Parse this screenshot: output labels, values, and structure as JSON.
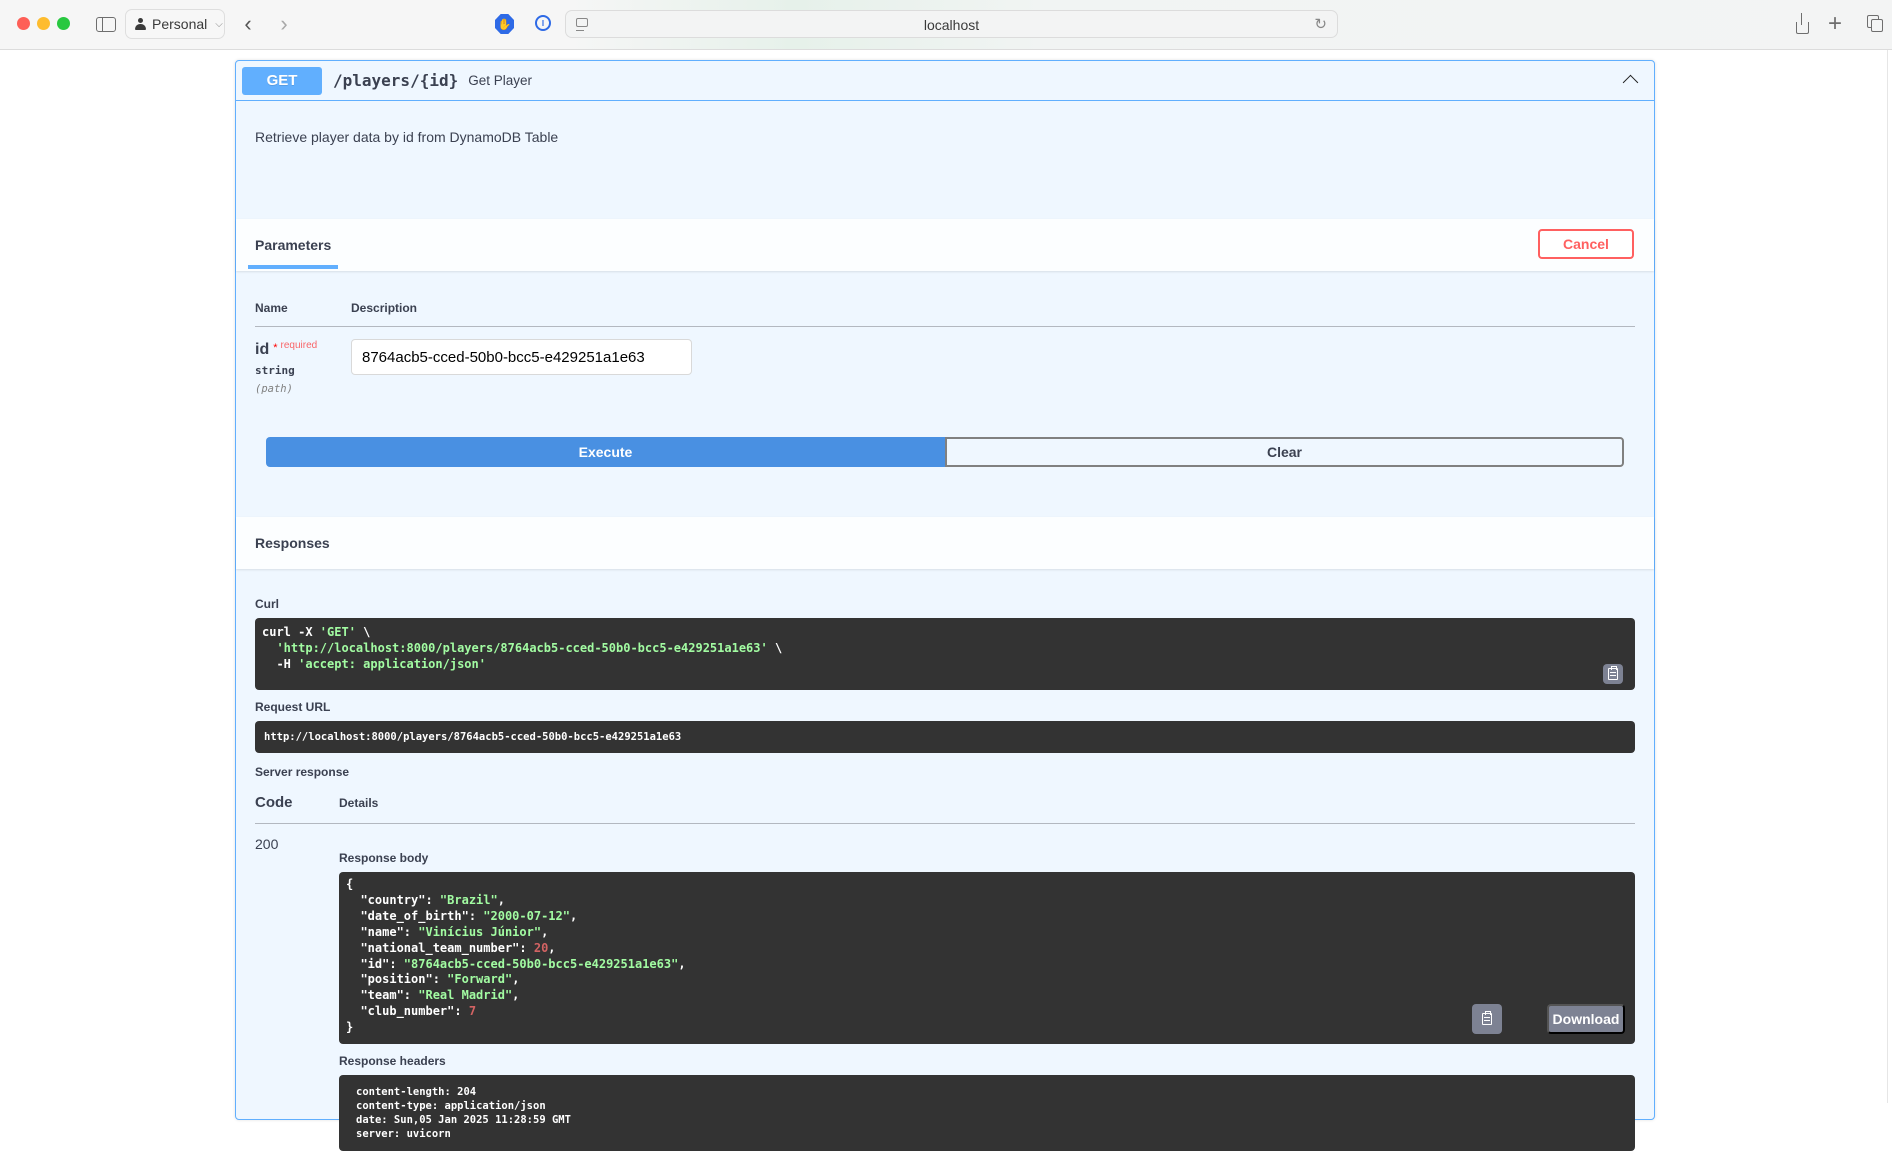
{
  "browser": {
    "profile_label": "Personal",
    "url": "localhost",
    "icons": [
      "sidebar-toggle-icon",
      "person-icon",
      "chevron-left-icon",
      "chevron-right-icon",
      "hand-block-extension-icon",
      "password-extension-icon",
      "page-icon",
      "reload-icon",
      "share-icon",
      "plus-icon",
      "tabs-overview-icon"
    ]
  },
  "operation": {
    "method": "GET",
    "path": "/players/{id}",
    "summary": "Get Player",
    "description": "Retrieve player data by id from DynamoDB Table",
    "method_color": "#61affe"
  },
  "parameters": {
    "tab_label": "Parameters",
    "cancel_label": "Cancel",
    "header_name": "Name",
    "header_description": "Description",
    "items": [
      {
        "name": "id",
        "required_star": "*",
        "required_label": "required",
        "type": "string",
        "in": "(path)",
        "value": "8764acb5-cced-50b0-bcc5-e429251a1e63"
      }
    ]
  },
  "actions": {
    "execute_label": "Execute",
    "clear_label": "Clear",
    "execute_color": "#4990e2"
  },
  "responses": {
    "title": "Responses",
    "curl_label": "Curl",
    "curl_lines": [
      {
        "plain": "curl -X ",
        "str": "'GET'",
        "tail": " \\"
      },
      {
        "plain": "  ",
        "str": "'http://localhost:8000/players/8764acb5-cced-50b0-bcc5-e429251a1e63'",
        "tail": " \\"
      },
      {
        "plain": "  -H ",
        "str": "'accept: application/json'",
        "tail": ""
      }
    ],
    "request_url_label": "Request URL",
    "request_url": "http://localhost:8000/players/8764acb5-cced-50b0-bcc5-e429251a1e63",
    "server_response_label": "Server response",
    "code_header": "Code",
    "details_header": "Details",
    "status_code": "200",
    "response_body_label": "Response body",
    "response_body": {
      "open": "{",
      "close": "}",
      "fields": [
        {
          "key": "\"country\"",
          "value": "\"Brazil\"",
          "kind": "s",
          "sep": ","
        },
        {
          "key": "\"date_of_birth\"",
          "value": "\"2000-07-12\"",
          "kind": "s",
          "sep": ","
        },
        {
          "key": "\"name\"",
          "value": "\"Vinícius Júnior\"",
          "kind": "s",
          "sep": ","
        },
        {
          "key": "\"national_team_number\"",
          "value": "20",
          "kind": "n",
          "sep": ","
        },
        {
          "key": "\"id\"",
          "value": "\"8764acb5-cced-50b0-bcc5-e429251a1e63\"",
          "kind": "s",
          "sep": ","
        },
        {
          "key": "\"position\"",
          "value": "\"Forward\"",
          "kind": "s",
          "sep": ","
        },
        {
          "key": "\"team\"",
          "value": "\"Real Madrid\"",
          "kind": "s",
          "sep": ","
        },
        {
          "key": "\"club_number\"",
          "value": "7",
          "kind": "n",
          "sep": ""
        }
      ]
    },
    "download_label": "Download",
    "response_headers_label": "Response headers",
    "response_headers": [
      "content-length: 204",
      "content-type: application/json",
      "date: Sun,05 Jan 2025 11:28:59 GMT",
      "server: uvicorn"
    ]
  }
}
